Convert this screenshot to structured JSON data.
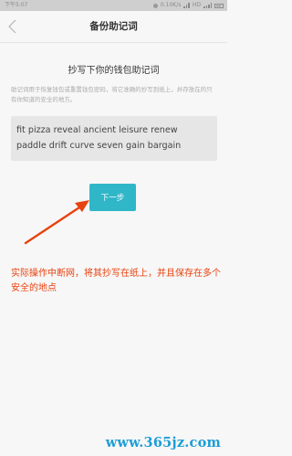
{
  "status_bar": {
    "time": "下午5:07",
    "network": "0.10K/s",
    "carrier": "HD"
  },
  "nav": {
    "title": "备份助记词",
    "back_icon": "chevron-left-icon"
  },
  "content": {
    "heading": "抄写下你的钱包助记词",
    "description": "助记词用于恢复钱包或重置钱包密码，将它准确的抄写到纸上，并存放在的只有你知道的安全的地方。",
    "mnemonic_lines": [
      "fit pizza reveal ancient leisure renew",
      "paddle drift curve seven gain bargain"
    ],
    "next_button_label": "下一步"
  },
  "annotation": {
    "text": "实际操作中断网，将其抄写在纸上，并且保存在多个安全的地点",
    "color": "#e8420f"
  },
  "watermark": "www.365jz.com",
  "colors": {
    "accent": "#2fb7c8",
    "watermark": "#1e9ed6"
  }
}
